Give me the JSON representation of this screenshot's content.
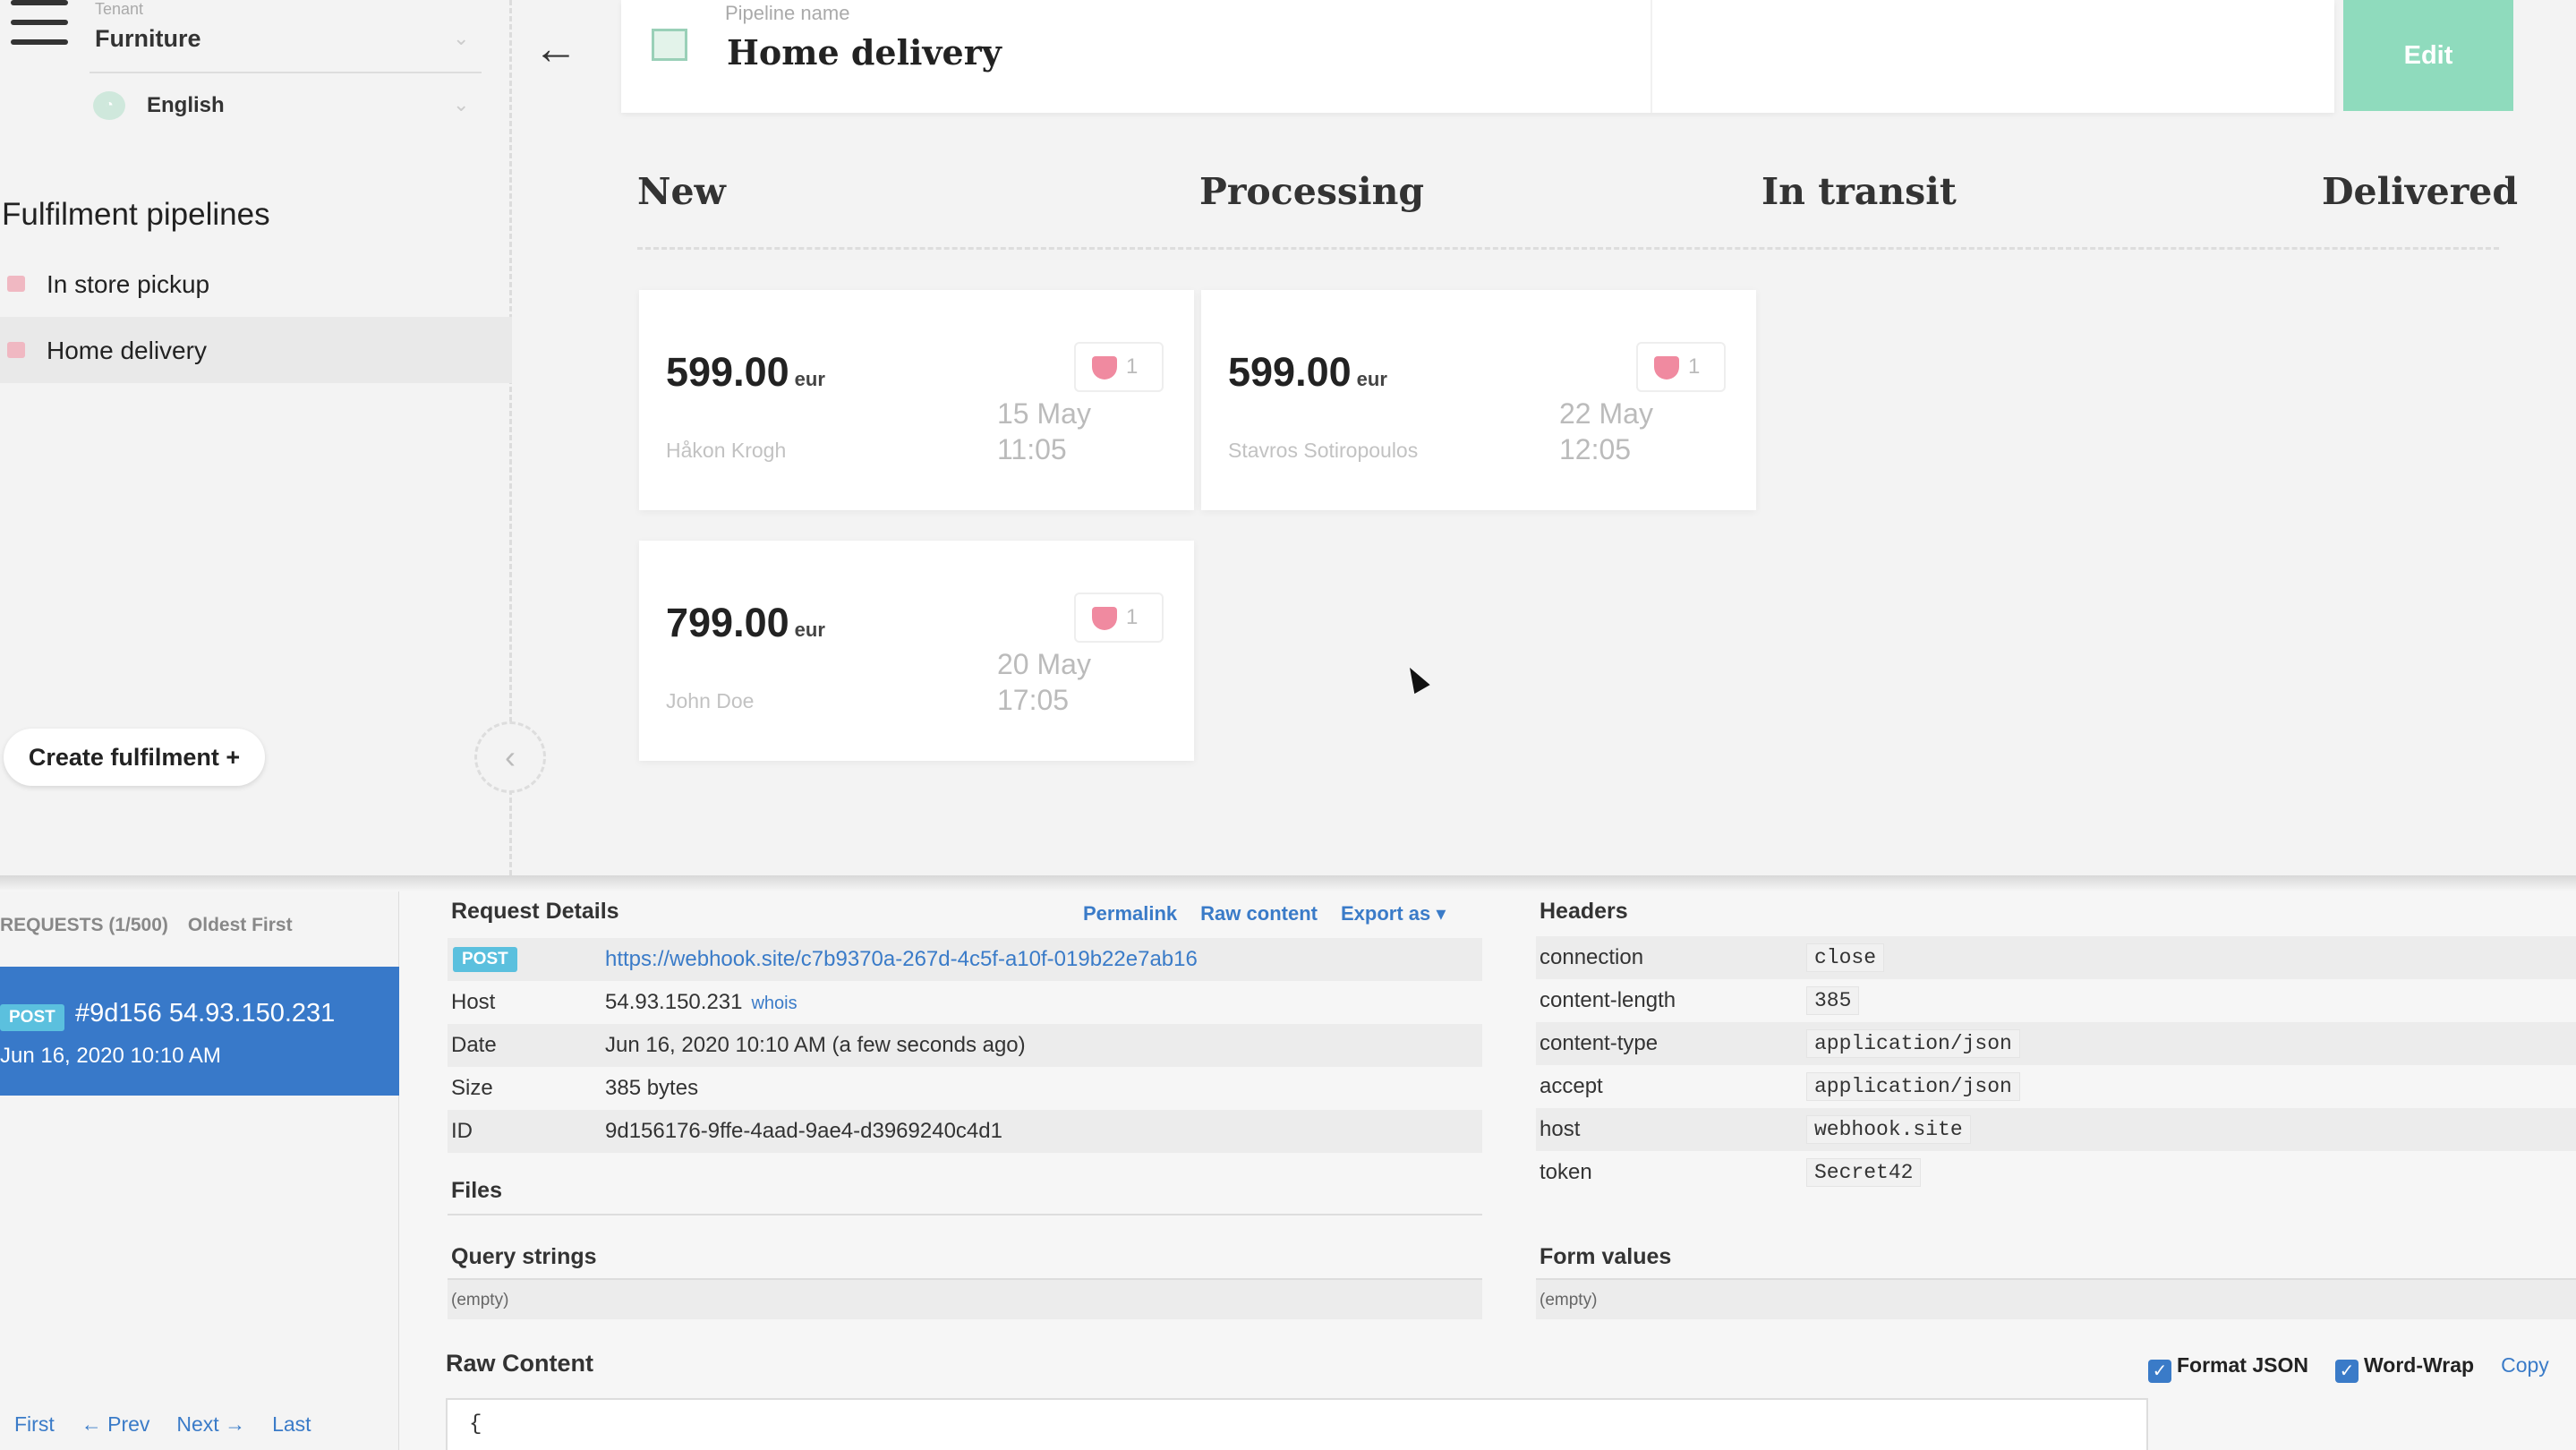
{
  "sidebar": {
    "tenant_label": "Tenant",
    "tenant_value": "Furniture",
    "language": "English",
    "section_title": "Fulfilment pipelines",
    "items": [
      {
        "label": "In store pickup"
      },
      {
        "label": "Home delivery"
      }
    ],
    "create_button": "Create fulfilment +"
  },
  "pipeline": {
    "label": "Pipeline name",
    "name": "Home delivery",
    "edit_button": "Edit"
  },
  "columns": [
    "New",
    "Processing",
    "In transit",
    "Delivered"
  ],
  "orders": [
    {
      "amount": "599.00",
      "currency": "eur",
      "customer": "Håkon Krogh",
      "date": "15 May",
      "time": "11:05",
      "count": "1"
    },
    {
      "amount": "599.00",
      "currency": "eur",
      "customer": "Stavros Sotiropoulos",
      "date": "22 May",
      "time": "12:05",
      "count": "1"
    },
    {
      "amount": "799.00",
      "currency": "eur",
      "customer": "John Doe",
      "date": "20 May",
      "time": "17:05",
      "count": "1"
    }
  ],
  "requests": {
    "header": "REQUESTS (1/500)",
    "sort": "Oldest First",
    "selected": {
      "method": "POST",
      "title": "#9d156 54.93.150.231",
      "when": "Jun 16, 2020 10:10 AM"
    },
    "pager": [
      "First",
      "← Prev",
      "Next →",
      "Last"
    ]
  },
  "details": {
    "title": "Request Details",
    "links": [
      "Permalink",
      "Raw content",
      "Export as ▾"
    ],
    "method": "POST",
    "url": "https://webhook.site/c7b9370a-267d-4c5f-a10f-019b22e7ab16",
    "rows": [
      {
        "key": "Host",
        "value": "54.93.150.231",
        "extra": "whois"
      },
      {
        "key": "Date",
        "value": "Jun 16, 2020 10:10 AM (a few seconds ago)"
      },
      {
        "key": "Size",
        "value": "385 bytes"
      },
      {
        "key": "ID",
        "value": "9d156176-9ffe-4aad-9ae4-d3969240c4d1"
      }
    ],
    "files_title": "Files",
    "query_title": "Query strings",
    "query_empty": "(empty)"
  },
  "headers": {
    "title": "Headers",
    "rows": [
      {
        "key": "connection",
        "value": "close"
      },
      {
        "key": "content-length",
        "value": "385"
      },
      {
        "key": "content-type",
        "value": "application/json"
      },
      {
        "key": "accept",
        "value": "application/json"
      },
      {
        "key": "host",
        "value": "webhook.site"
      },
      {
        "key": "token",
        "value": "Secret42"
      }
    ],
    "form_title": "Form values",
    "form_empty": "(empty)"
  },
  "raw": {
    "title": "Raw Content",
    "format_json": "Format JSON",
    "word_wrap": "Word-Wrap",
    "copy": "Copy",
    "content": "{"
  }
}
